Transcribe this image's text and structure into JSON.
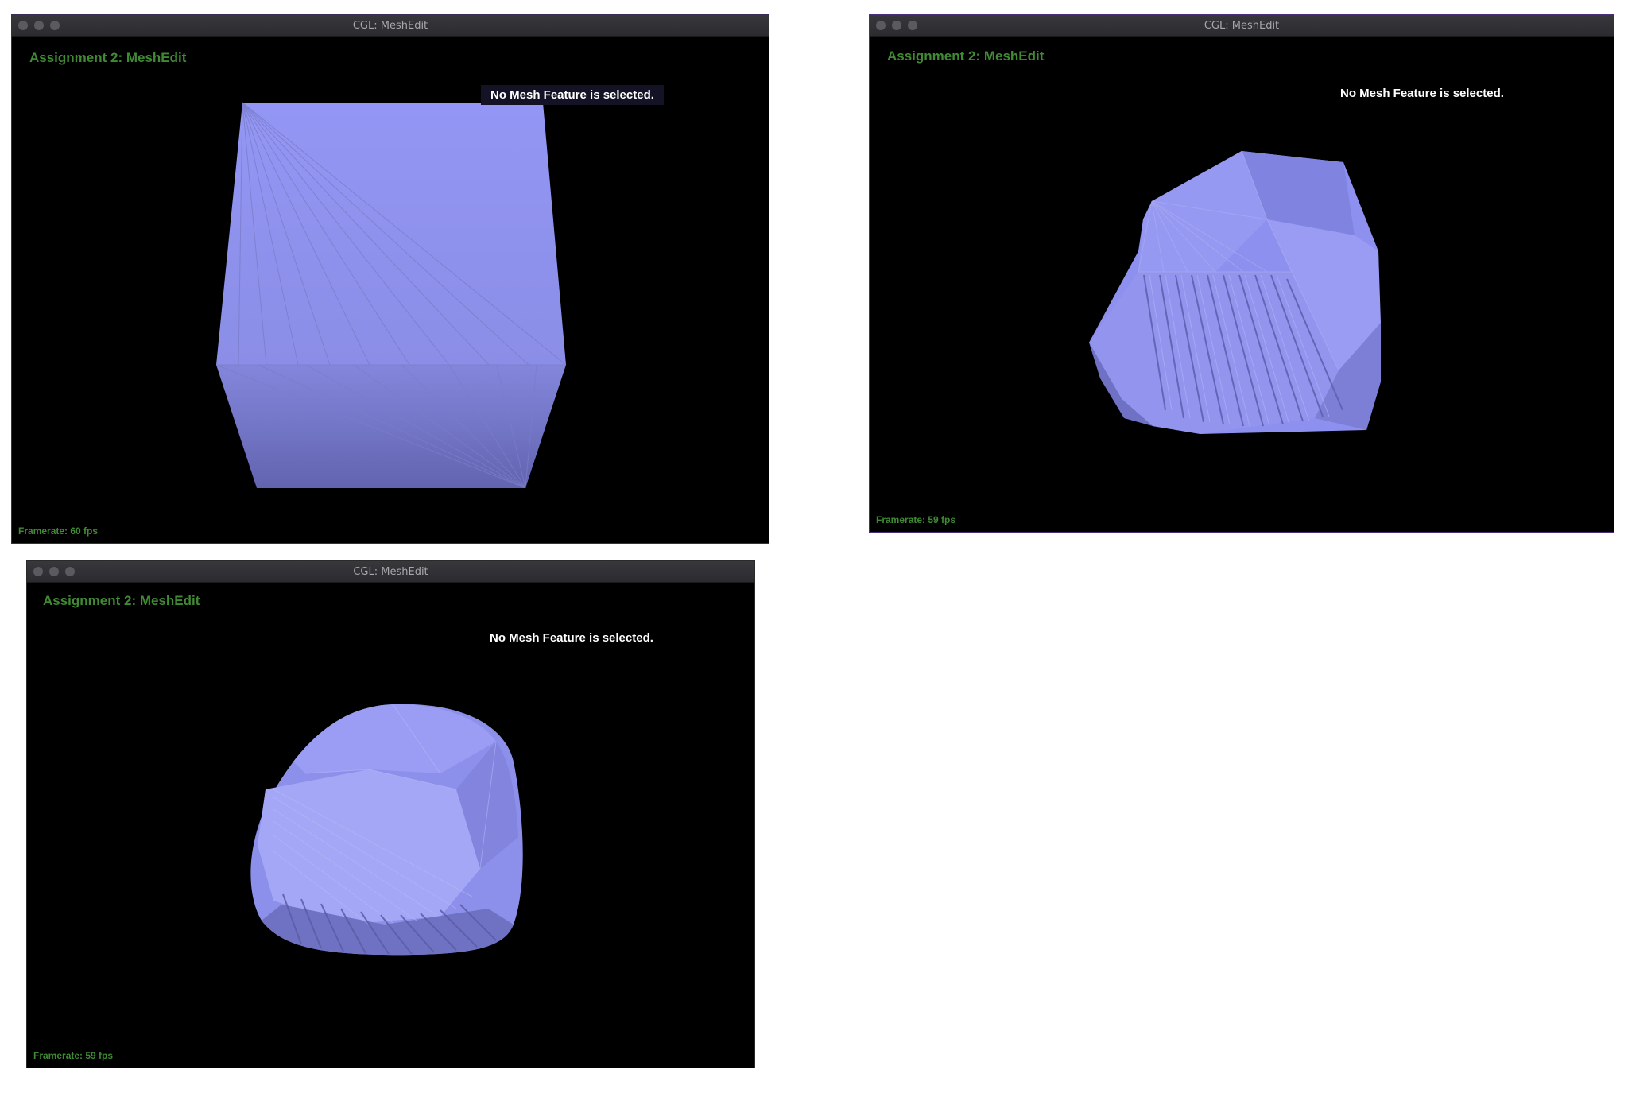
{
  "windows": [
    {
      "title": "CGL: MeshEdit",
      "app_title": "Assignment 2: MeshEdit",
      "status": "No Mesh Feature is selected.",
      "framerate": "Framerate: 60 fps"
    },
    {
      "title": "CGL: MeshEdit",
      "app_title": "Assignment 2: MeshEdit",
      "status": "No Mesh Feature is selected.",
      "framerate": "Framerate: 59 fps"
    },
    {
      "title": "CGL: MeshEdit",
      "app_title": "Assignment 2: MeshEdit",
      "status": "No Mesh Feature is selected.",
      "framerate": "Framerate: 59 fps"
    }
  ],
  "colors": {
    "mesh_light": "#9a9cf4",
    "mesh_dark": "#6a6bb5",
    "label_green": "#3f8a33"
  }
}
